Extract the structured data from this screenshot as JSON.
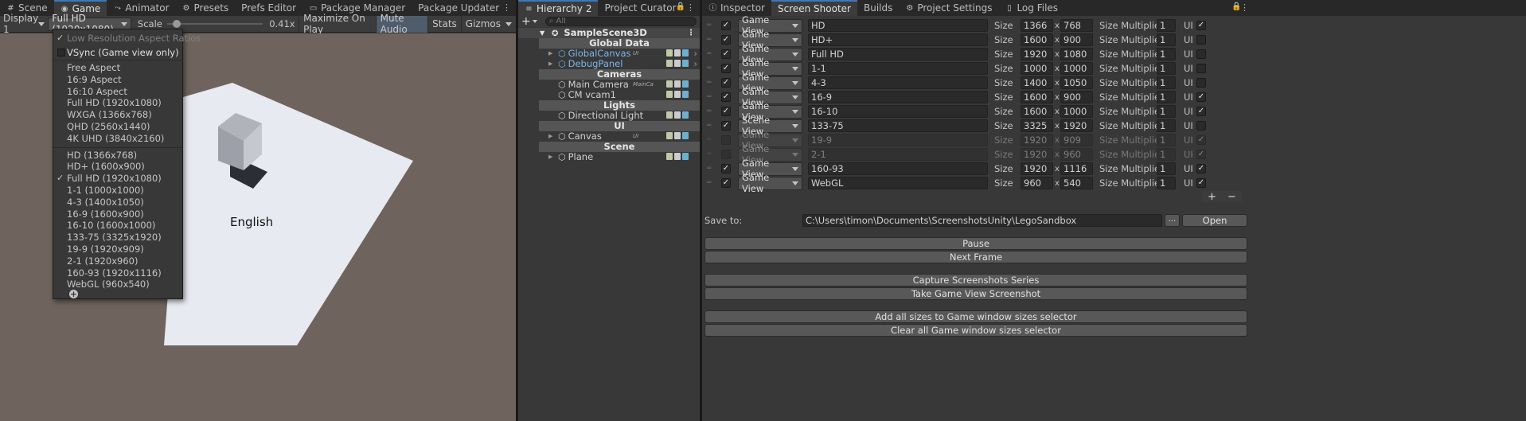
{
  "game_panel": {
    "tabs": [
      {
        "label": "Scene",
        "icon": "grid-icon"
      },
      {
        "label": "Game",
        "icon": "gamepad-icon"
      },
      {
        "label": "Animator",
        "icon": "animator-icon"
      },
      {
        "label": "Presets",
        "icon": "presets-icon"
      },
      {
        "label": "Prefs Editor",
        "icon": ""
      },
      {
        "label": "Package Manager",
        "icon": "package-icon"
      },
      {
        "label": "Package Updater",
        "icon": ""
      }
    ],
    "toolbar": {
      "display": "Display 1",
      "resolution": "Full HD (1920x1080)",
      "scale_label": "Scale",
      "scale_value": "0.41x",
      "scale_fraction": 0.05,
      "maximize": "Maximize On Play",
      "mute": "Mute Audio",
      "stats": "Stats",
      "gizmos": "Gizmos"
    },
    "scene_text": "English",
    "menu": {
      "group1": [
        {
          "label": "Low Resolution Aspect Ratios",
          "checked": true,
          "dim": true
        },
        {
          "label": "VSync (Game view only)",
          "checked": false,
          "box": true
        }
      ],
      "group2": [
        "Free Aspect",
        "16:9 Aspect",
        "16:10 Aspect",
        "Full HD (1920x1080)",
        "WXGA (1366x768)",
        "QHD (2560x1440)",
        "4K UHD (3840x2160)"
      ],
      "group3": [
        "HD (1366x768)",
        "HD+ (1600x900)",
        "Full HD (1920x1080)",
        "1-1 (1000x1000)",
        "4-3 (1400x1050)",
        "16-9 (1600x900)",
        "16-10 (1600x1000)",
        "133-75 (3325x1920)",
        "19-9 (1920x909)",
        "2-1 (1920x960)",
        "160-93 (1920x1116)",
        "WebGL (960x540)"
      ],
      "selected": "Full HD (1920x1080)"
    }
  },
  "hierarchy": {
    "tabs": [
      "Hierarchy 2",
      "Project Curator"
    ],
    "search_placeholder": "All",
    "scene_name": "SampleScene3D",
    "rows": [
      {
        "type": "header",
        "label": "Global Data"
      },
      {
        "type": "item",
        "label": "GlobalCanvas",
        "prefab": true,
        "arrow": true,
        "tag": "UI"
      },
      {
        "type": "item",
        "label": "DebugPanel",
        "prefab": true,
        "arrow": true,
        "tag": ""
      },
      {
        "type": "header",
        "label": "Cameras"
      },
      {
        "type": "item",
        "label": "Main Camera",
        "prefab": false,
        "arrow": false,
        "tag": "MainCa"
      },
      {
        "type": "item",
        "label": "CM vcam1",
        "prefab": false,
        "arrow": false,
        "tag": ""
      },
      {
        "type": "header",
        "label": "Lights"
      },
      {
        "type": "item",
        "label": "Directional Light",
        "prefab": false,
        "arrow": false,
        "tag": ""
      },
      {
        "type": "header",
        "label": "UI"
      },
      {
        "type": "item",
        "label": "Canvas",
        "prefab": false,
        "arrow": true,
        "tag": "UI"
      },
      {
        "type": "header",
        "label": "Scene"
      },
      {
        "type": "item",
        "label": "Plane",
        "prefab": false,
        "arrow": true,
        "tag": ""
      }
    ]
  },
  "inspector": {
    "tabs": [
      {
        "label": "Inspector",
        "icon": "info-icon"
      },
      {
        "label": "Screen Shooter",
        "icon": ""
      },
      {
        "label": "Builds",
        "icon": ""
      },
      {
        "label": "Project Settings",
        "icon": "gear-icon"
      },
      {
        "label": "Log Files",
        "icon": "file-icon"
      }
    ],
    "size_label": "Size",
    "times": "x",
    "multiplier_label": "Size Multiplier",
    "ui_label": "UI",
    "rows": [
      {
        "enabled": true,
        "view": "Game View",
        "name": "HD",
        "w": "1366",
        "h": "768",
        "mult": "1",
        "ui": true
      },
      {
        "enabled": true,
        "view": "Game View",
        "name": "HD+",
        "w": "1600",
        "h": "900",
        "mult": "1",
        "ui": false
      },
      {
        "enabled": true,
        "view": "Game View",
        "name": "Full HD",
        "w": "1920",
        "h": "1080",
        "mult": "1",
        "ui": false
      },
      {
        "enabled": true,
        "view": "Game View",
        "name": "1-1",
        "w": "1000",
        "h": "1000",
        "mult": "1",
        "ui": false
      },
      {
        "enabled": true,
        "view": "Game View",
        "name": "4-3",
        "w": "1400",
        "h": "1050",
        "mult": "1",
        "ui": false
      },
      {
        "enabled": true,
        "view": "Game View",
        "name": "16-9",
        "w": "1600",
        "h": "900",
        "mult": "1",
        "ui": true
      },
      {
        "enabled": true,
        "view": "Game View",
        "name": "16-10",
        "w": "1600",
        "h": "1000",
        "mult": "1",
        "ui": true
      },
      {
        "enabled": true,
        "view": "Scene View",
        "name": "133-75",
        "w": "3325",
        "h": "1920",
        "mult": "1",
        "ui": false
      },
      {
        "enabled": false,
        "view": "Game View",
        "name": "19-9",
        "w": "1920",
        "h": "909",
        "mult": "1",
        "ui": true
      },
      {
        "enabled": false,
        "view": "Game View",
        "name": "2-1",
        "w": "1920",
        "h": "960",
        "mult": "1",
        "ui": true
      },
      {
        "enabled": true,
        "view": "Game View",
        "name": "160-93",
        "w": "1920",
        "h": "1116",
        "mult": "1",
        "ui": true
      },
      {
        "enabled": true,
        "view": "Game View",
        "name": "WebGL",
        "w": "960",
        "h": "540",
        "mult": "1",
        "ui": true
      }
    ],
    "add_label": "+",
    "remove_label": "−",
    "save_to_label": "Save to:",
    "save_path": "C:\\Users\\timon\\Documents\\ScreenshotsUnity\\LegoSandbox",
    "browse_label": "...",
    "open_label": "Open",
    "buttons": {
      "pause": "Pause",
      "next_frame": "Next Frame",
      "capture_series": "Capture Screenshots Series",
      "take_game": "Take Game View Screenshot",
      "add_all": "Add all sizes to Game window sizes selector",
      "clear_all": "Clear all Game window sizes selector"
    }
  }
}
